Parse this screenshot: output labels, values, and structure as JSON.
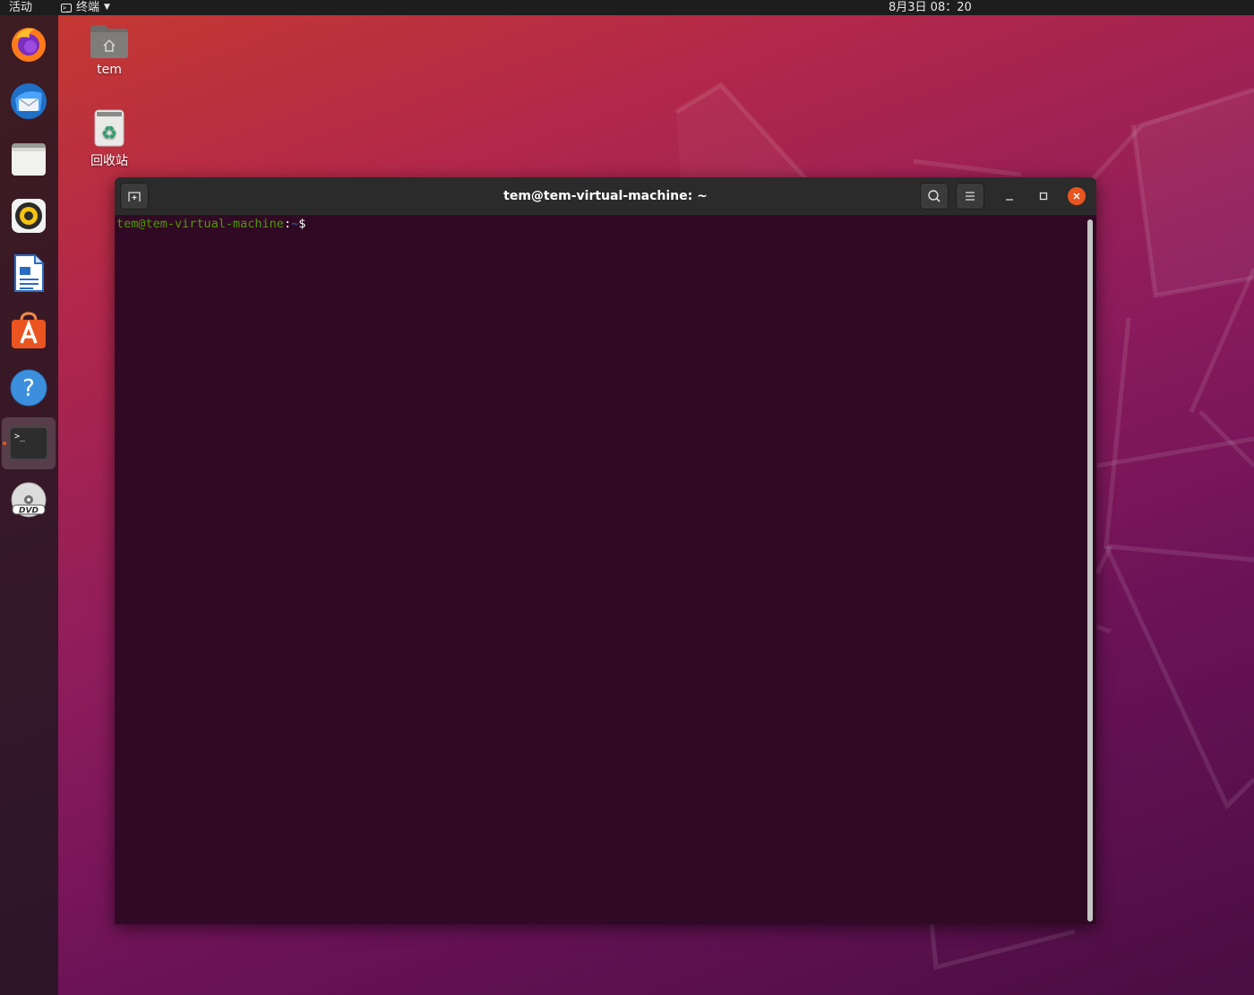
{
  "topbar": {
    "activities": "活动",
    "app_menu_label": "终端",
    "clock": "8月3日  08：20"
  },
  "dock": {
    "items": [
      {
        "name": "firefox",
        "icon": "firefox-icon"
      },
      {
        "name": "thunderbird",
        "icon": "thunderbird-mail-icon"
      },
      {
        "name": "files",
        "icon": "files-folder-icon"
      },
      {
        "name": "rhythmbox",
        "icon": "rhythmbox-speaker-icon"
      },
      {
        "name": "libreoffice-writer",
        "icon": "writer-document-icon"
      },
      {
        "name": "ubuntu-software",
        "icon": "software-store-icon"
      },
      {
        "name": "help",
        "icon": "help-icon"
      },
      {
        "name": "terminal",
        "icon": "terminal-icon",
        "active": true
      },
      {
        "name": "dvd",
        "icon": "dvd-disc-icon"
      }
    ]
  },
  "desktop": {
    "icons": [
      {
        "label": "tem",
        "icon": "home-folder-icon"
      },
      {
        "label": "回收站",
        "icon": "trash-icon"
      }
    ]
  },
  "terminal": {
    "title": "tem@tem-virtual-machine: ~",
    "prompt": {
      "user_host": "tem@tem-virtual-machine",
      "colon": ":",
      "path": "~",
      "dollar": "$"
    }
  },
  "colors": {
    "accent": "#e95420",
    "terminal_bg": "#300a24",
    "prompt_user": "#4e9a06",
    "prompt_path": "#3465a4"
  }
}
